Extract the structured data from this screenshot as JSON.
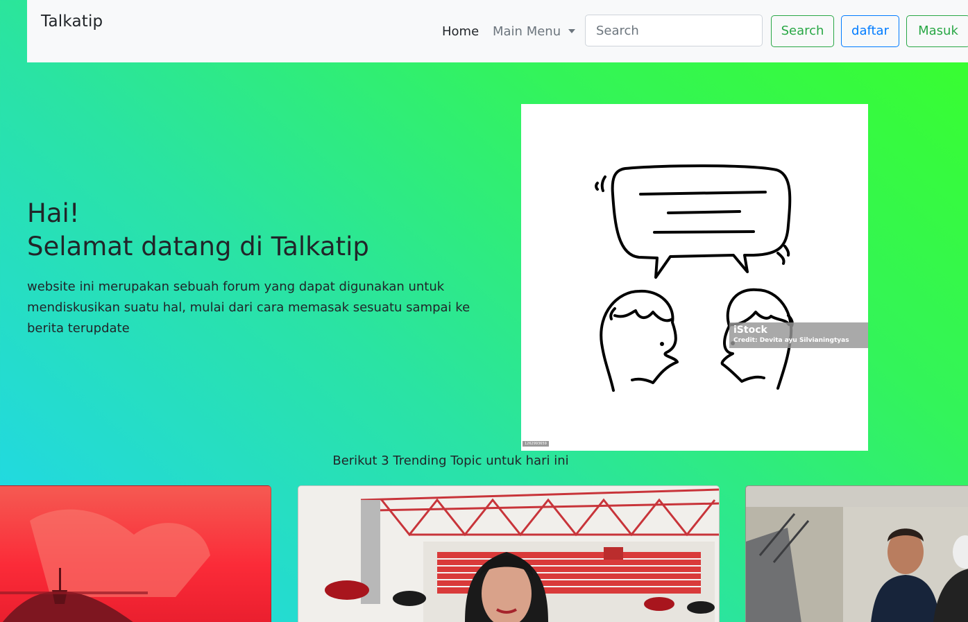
{
  "navbar": {
    "brand": "Talkatip",
    "home_label": "Home",
    "main_menu_label": "Main Menu",
    "search_placeholder": "Search",
    "search_button": "Search",
    "daftar_button": "daftar",
    "masuk_button": "Masuk"
  },
  "hero": {
    "greeting": "Hai!",
    "title": "Selamat datang di Talkatip",
    "description": "website ini merupakan sebuah forum yang dapat digunakan untuk mendiskusikan suatu hal, mulai dari cara memasak sesuatu sampai ke berita terupdate",
    "image": {
      "watermark_brand": "iStock",
      "watermark_credit": "Credit: Devita ayu Silvianingtyas",
      "image_id": "1262993659"
    }
  },
  "trending": {
    "heading": "Berikut 3 Trending Topic untuk hari ini"
  },
  "colors": {
    "gradient_top_right": "#39ff2a",
    "gradient_bottom_left": "#1fd6f2",
    "btn_success": "#28a745",
    "btn_primary": "#007bff",
    "navbar_bg": "#f8f9fa"
  }
}
